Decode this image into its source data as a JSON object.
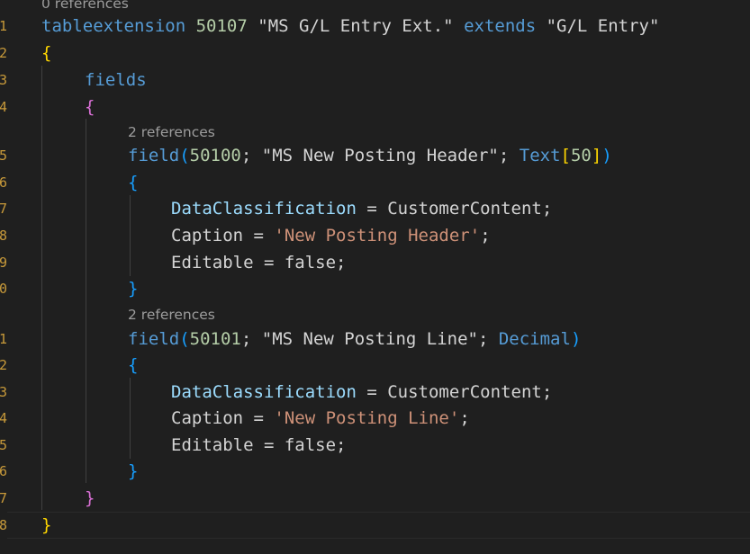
{
  "editor": {
    "lens_top": "0 references",
    "lens_field1": "2 references",
    "lens_field2": "2 references",
    "line_numbers": [
      "1",
      "2",
      "3",
      "4",
      "5",
      "6",
      "7",
      "8",
      "9",
      "0",
      "1",
      "2",
      "3",
      "4",
      "5",
      "6",
      "7",
      "8"
    ],
    "code": {
      "l1_kw": "tableextension",
      "l1_id": "50107",
      "l1_name": "\"MS G/L Entry Ext.\"",
      "l1_extends": "extends",
      "l1_target": "\"G/L Entry\"",
      "open_brace": "{",
      "close_brace": "}",
      "fields_kw": "fields",
      "field_fn": "field",
      "open_paren": "(",
      "close_paren": ")",
      "semi": ";",
      "comma_sep": "; ",
      "f1_id": "50100",
      "f1_name": "\"MS New Posting Header\"",
      "f1_type": "Text",
      "f1_len_open": "[",
      "f1_len": "50",
      "f1_len_close": "]",
      "f2_id": "50101",
      "f2_name": "\"MS New Posting Line\"",
      "f2_type": "Decimal",
      "prop_dataclass": "DataClassification",
      "prop_dataclass_val": "CustomerContent",
      "prop_caption": "Caption",
      "f1_caption": "'New Posting Header'",
      "f2_caption": "'New Posting Line'",
      "prop_editable": "Editable",
      "val_false": "false",
      "eq": " = "
    }
  },
  "colors": {
    "background": "#1f1f1f",
    "keyword": "#569cd6",
    "string": "#ce9178",
    "number": "#b5cea8",
    "property": "#9cdcfe",
    "bracket_level1": "#ffd700",
    "bracket_level2": "#da70d6",
    "bracket_level3": "#179fff",
    "line_number": "#c89a3a",
    "codelens": "#9d9d9d"
  }
}
